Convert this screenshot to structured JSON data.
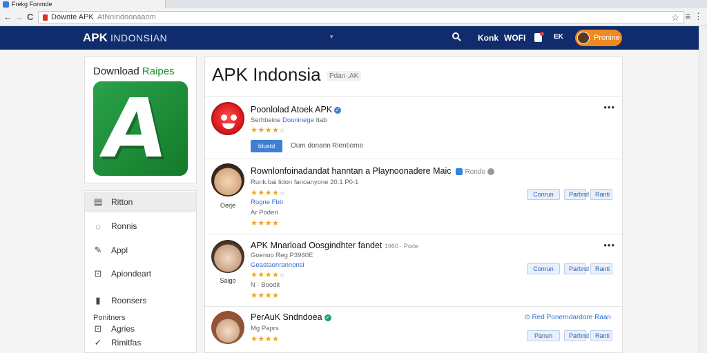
{
  "browser": {
    "tab_title": "Frekg Fonmde",
    "url_domain": "Downte APK",
    "url_path": "AtNnlndoonaaom",
    "back": "←",
    "forward": "→",
    "reload": "C",
    "star": "☆",
    "menu": "≡",
    "kebab": "⋮"
  },
  "header": {
    "logo": "APK",
    "logo_sub": "INDONSIAN",
    "dropdown_icon": "▾",
    "search_icon": "🔍",
    "link_1": "Konk",
    "link_2": "WOFI",
    "link_3": "EK",
    "user_label": "Pronine"
  },
  "promo": {
    "title_black": "Download",
    "title_green": "Raipes",
    "icon_letter": "A"
  },
  "sidenav": {
    "items": [
      {
        "icon": "▤",
        "label": "Ritton"
      },
      {
        "icon": "◌",
        "label": "Ronnis"
      },
      {
        "icon": "✎",
        "label": "Appl"
      },
      {
        "icon": "⊡",
        "label": "Apiondeart"
      },
      {
        "icon": "▮",
        "label": "Roonsers"
      }
    ],
    "section_heading": "Ponitners",
    "sub_items": [
      {
        "icon": "⊡",
        "label": "Agries"
      },
      {
        "icon": "✓",
        "label": "Rimitfas"
      }
    ]
  },
  "main": {
    "title": "APK Indonsia",
    "title_tag": "Pdan .AK",
    "apps": [
      {
        "title": "Poonlolad Atoek APK",
        "verified": "✓",
        "meta_gray": "Serhbeine",
        "meta_blue": "Dooninege",
        "meta_gray2": "Itab",
        "stars": "★★★★",
        "star_rest": "☆",
        "primary_btn": "Idustd",
        "link_1": "Oum donann",
        "link_2": "Rientiome",
        "more": "•••"
      },
      {
        "title": "Rownlonfoinadandat hanntan a Playnoonadere Maic",
        "tag": "Rondo",
        "icon_label": "Oerje",
        "meta_line": "Runk.bai lidon fanoanyone 20.1 P0-1",
        "stars_a": "★★★★",
        "stars_a_rest": "☆",
        "meta_blue": "Rogne Fbb",
        "meta_gray": "Ar Poderi",
        "stars_b": "★★★★",
        "btn_1": "Conrun",
        "btn_2": "Parbnd",
        "btn_3": "Ranti"
      },
      {
        "title": "APK Mnarload Oosgindhter fandet",
        "tag": "1960 · Pode",
        "icon_label": "Saigo",
        "meta_gray": "Goenoo Reg P3960E",
        "meta_blue": "Geastaonrannonsi",
        "stars_a": "★★★★",
        "stars_a_rest": "☆",
        "meta_gray2": "N · Boodit",
        "stars_b": "★★★★",
        "btn_1": "Conrun",
        "btn_2": "Parbnd",
        "btn_3": "Ranti",
        "more": "•••"
      },
      {
        "title": "PerAuK Sndndoea",
        "verified": "✓",
        "meta_gray": "Mg Paprs",
        "stars": "★★★★",
        "get_link": "⊙ Red Ponerndardore Raan",
        "btn_1": "Panun",
        "btn_2": "Parbnd",
        "btn_3": "Ranti"
      }
    ]
  },
  "colors": {
    "header_bg": "#102c6c",
    "accent_orange": "#f08a1e",
    "brand_green": "#1b8a35",
    "link_blue": "#2f6fd0",
    "star_gold": "#f0a21e"
  }
}
